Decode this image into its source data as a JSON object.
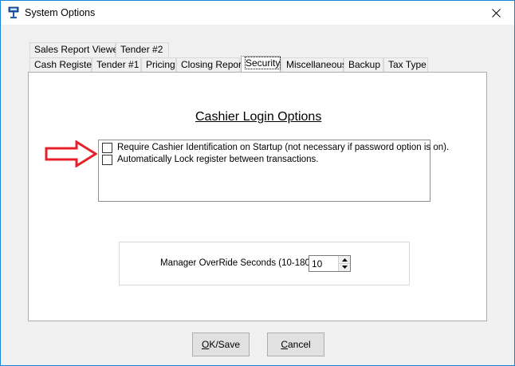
{
  "window": {
    "title": "System Options",
    "icon": "register-icon",
    "close_icon": "close-icon"
  },
  "tabs_row1": [
    {
      "label": "Sales Report Viewer"
    },
    {
      "label": "Tender #2"
    }
  ],
  "tabs_row2": [
    {
      "label": "Cash Register"
    },
    {
      "label": "Tender #1"
    },
    {
      "label": "Pricing"
    },
    {
      "label": "Closing Report"
    },
    {
      "label": "Security",
      "active": true
    },
    {
      "label": "Miscellaneous"
    },
    {
      "label": "Backup"
    },
    {
      "label": "Tax Type"
    }
  ],
  "security": {
    "section_title": "Cashier Login Options",
    "options": [
      {
        "label": "Require Cashier Identification on Startup (not necessary if password option is on).",
        "checked": false
      },
      {
        "label": "Automatically Lock register between transactions.",
        "checked": false
      }
    ],
    "override": {
      "label": "Manager OverRide Seconds (10-180):",
      "value": "10"
    }
  },
  "buttons": {
    "ok_first": "O",
    "ok_rest": "K/Save",
    "cancel_first": "C",
    "cancel_rest": "ancel"
  },
  "colors": {
    "arrow": "#e8202a",
    "window_border": "#1883d7"
  }
}
